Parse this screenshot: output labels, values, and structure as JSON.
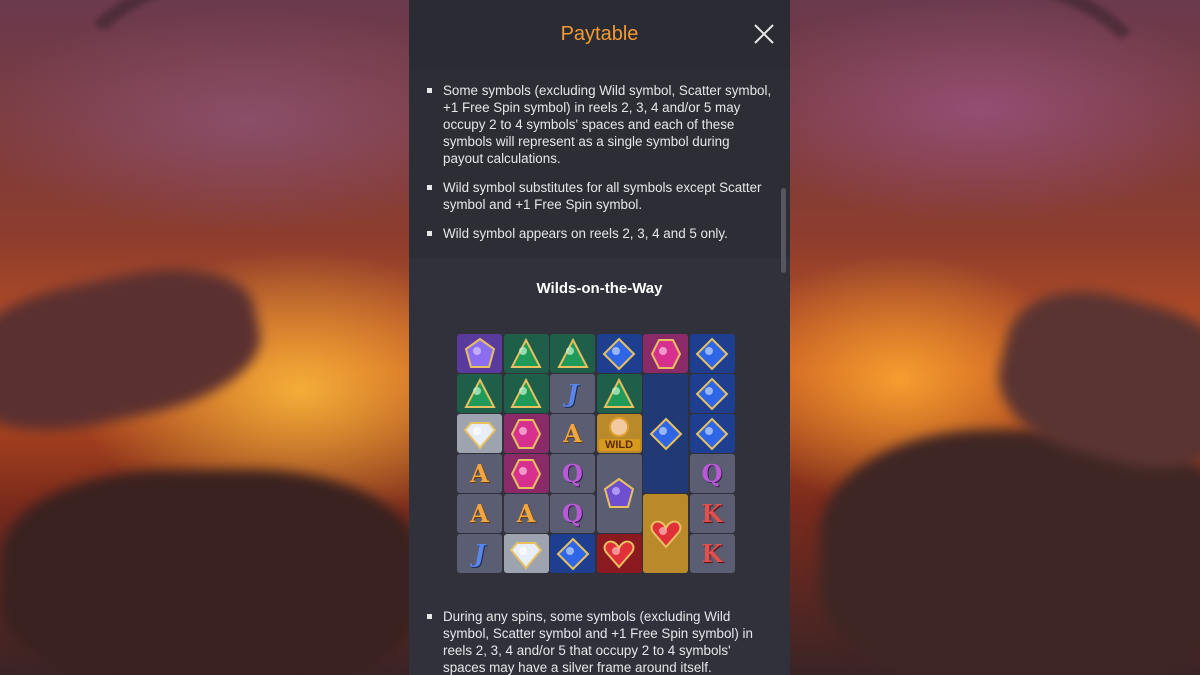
{
  "panel": {
    "title": "Paytable",
    "close_icon": "close-icon"
  },
  "rules": [
    "Some symbols (excluding Wild symbol, Scatter symbol, +1 Free Spin symbol) in reels 2, 3, 4 and/or 5 may occupy 2 to 4 symbols' spaces and each of these symbols will represent as a single symbol during payout calculations.",
    "Wild symbol substitutes for all symbols except Scatter symbol and +1 Free Spin symbol.",
    "Wild symbol appears on reels 2, 3, 4 and 5 only."
  ],
  "section": {
    "title": "Wilds-on-the-Way"
  },
  "grid": {
    "tiles": [
      {
        "symbol": "purple-gem",
        "letter": ""
      },
      {
        "symbol": "green-gem",
        "letter": ""
      },
      {
        "symbol": "green-gem",
        "letter": ""
      },
      {
        "symbol": "blue-gem",
        "letter": ""
      },
      {
        "symbol": "pink-gem",
        "letter": ""
      },
      {
        "symbol": "blue-gem",
        "letter": ""
      },
      {
        "symbol": "green-gem",
        "letter": ""
      },
      {
        "symbol": "green-gem",
        "letter": ""
      },
      {
        "symbol": "J",
        "letter": "J"
      },
      {
        "symbol": "green-gem",
        "letter": ""
      },
      {
        "symbol": "blue-gem-tall",
        "letter": ""
      },
      {
        "symbol": "blue-gem",
        "letter": ""
      },
      {
        "symbol": "diamond",
        "letter": ""
      },
      {
        "symbol": "pink-gem",
        "letter": ""
      },
      {
        "symbol": "A",
        "letter": "A"
      },
      {
        "symbol": "wild",
        "letter": "WILD"
      },
      {
        "symbol": "blue-gem",
        "letter": ""
      },
      {
        "symbol": "A",
        "letter": "A"
      },
      {
        "symbol": "pink-gem",
        "letter": ""
      },
      {
        "symbol": "Q",
        "letter": "Q"
      },
      {
        "symbol": "purple-gem-tall",
        "letter": ""
      },
      {
        "symbol": "Q",
        "letter": "Q"
      },
      {
        "symbol": "A",
        "letter": "A"
      },
      {
        "symbol": "A",
        "letter": "A"
      },
      {
        "symbol": "Q",
        "letter": "Q"
      },
      {
        "symbol": "heart-tall",
        "letter": ""
      },
      {
        "symbol": "K",
        "letter": "K"
      },
      {
        "symbol": "J",
        "letter": "J"
      },
      {
        "symbol": "diamond",
        "letter": ""
      },
      {
        "symbol": "blue-gem",
        "letter": ""
      },
      {
        "symbol": "heart",
        "letter": ""
      },
      {
        "symbol": "K",
        "letter": "K"
      }
    ]
  },
  "bottom_rule": "During any spins, some symbols (excluding Wild symbol, Scatter symbol and +1 Free Spin symbol) in reels 2, 3, 4 and/or 5 that occupy 2 to 4 symbols' spaces may have a silver frame around itself."
}
